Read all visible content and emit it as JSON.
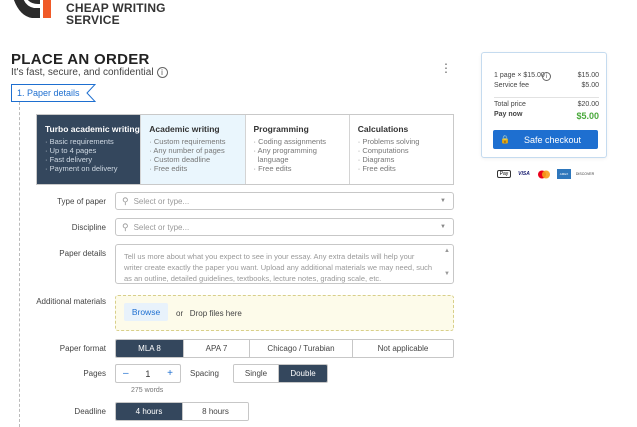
{
  "brand": {
    "line1": "CHEAP WRITING",
    "line2": "SERVICE"
  },
  "header": {
    "title": "PLACE AN ORDER",
    "subtitle": "It's fast, secure, and confidential",
    "menu_glyph": "⋮"
  },
  "step": {
    "label": "1.  Paper details"
  },
  "service_cards": [
    {
      "title": "Turbo academic writing",
      "features": [
        "Basic requirements",
        "Up to 4 pages",
        "Fast delivery",
        "Payment on delivery"
      ]
    },
    {
      "title": "Academic writing",
      "features": [
        "Custom requirements",
        "Any number of pages",
        "Custom deadline",
        "Free edits"
      ]
    },
    {
      "title": "Programming",
      "features": [
        "Coding assignments",
        "Any programming",
        "language",
        "Free edits"
      ]
    },
    {
      "title": "Calculations",
      "features": [
        "Problems solving",
        "Computations",
        "Diagrams",
        "Free edits"
      ]
    }
  ],
  "form": {
    "type_of_paper": {
      "label": "Type of paper",
      "placeholder": "Select or type..."
    },
    "discipline": {
      "label": "Discipline",
      "placeholder": "Select or type..."
    },
    "paper_details": {
      "label": "Paper details",
      "placeholder": "Tell us more about what you expect to see in your essay. Any extra details will help your writer create exactly the paper you want. Upload any additional materials we may need, such as an outline, detailed guidelines, textbooks, lecture notes, grading scale, etc."
    },
    "additional_materials": {
      "label": "Additional materials",
      "browse": "Browse",
      "or": "or",
      "drop": "Drop files here"
    },
    "paper_format": {
      "label": "Paper format",
      "options": [
        "MLA 8",
        "APA 7",
        "Chicago / Turabian",
        "Not applicable"
      ],
      "selected": "MLA 8"
    },
    "pages": {
      "label": "Pages",
      "value": "1",
      "minus": "–",
      "plus": "+",
      "words": "275 words"
    },
    "spacing": {
      "label": "Spacing",
      "options": [
        "Single",
        "Double"
      ],
      "selected": "Double"
    },
    "deadline": {
      "label": "Deadline",
      "options": [
        "4 hours",
        "8 hours"
      ],
      "selected": "4 hours"
    }
  },
  "summary": {
    "pages_line": "1 page × $15.00",
    "pages_amount": "$15.00",
    "service_fee_label": "Service fee",
    "service_fee": "$5.00",
    "total_label": "Total price",
    "total": "$20.00",
    "pay_now_label": "Pay now",
    "pay_now": "$5.00",
    "checkout": "Safe checkout"
  },
  "payment_methods": [
    "Apple Pay",
    "VISA",
    "Mastercard",
    "American Express",
    "Discover"
  ],
  "colors": {
    "accent": "#1e6fd0",
    "selected_dark": "#34475d",
    "logo_orange": "#f05a28",
    "pay_green": "#49a93b"
  }
}
